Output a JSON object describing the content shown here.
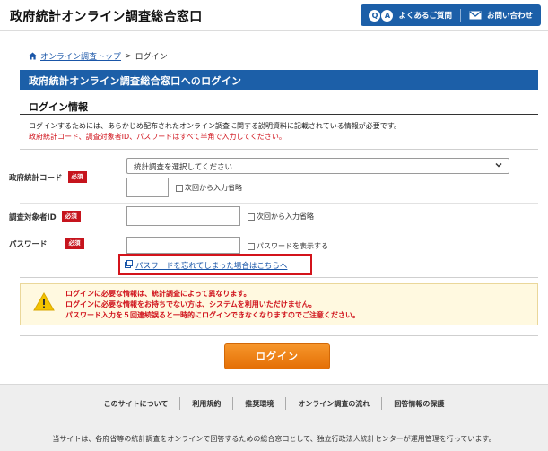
{
  "header": {
    "site_title": "政府統計オンライン調査総合窓口",
    "faq_label": "よくあるご質問",
    "contact_label": "お問い合わせ",
    "brand_color": "#1c5fa8"
  },
  "breadcrumb": {
    "home_label": "オンライン調査トップ",
    "separator": ">",
    "current": "ログイン"
  },
  "page_heading": "政府統計オンライン調査総合窓口へのログイン",
  "section_title": "ログイン情報",
  "intro": {
    "line1": "ログインするためには、あらかじめ配布されたオンライン調査に関する説明資料に記載されている情報が必要です。",
    "line2": "政府統計コード、調査対象者ID、パスワードはすべて半角で入力してください。"
  },
  "form": {
    "required_badge": "必須",
    "survey_code": {
      "label": "政府統計コード",
      "select_value": "統計調査を選択してください",
      "checkbox_label": "次回から入力省略"
    },
    "respondent_id": {
      "label": "調査対象者ID",
      "checkbox_label": "次回から入力省略"
    },
    "password": {
      "label": "パスワード",
      "checkbox_label": "パスワードを表示する"
    },
    "forgot_link": "パスワードを忘れてしまった場合はこちらへ"
  },
  "warning": {
    "line1": "ログインに必要な情報は、統計調査によって異なります。",
    "line2": "ログインに必要な情報をお持ちでない方は、システムを利用いただけません。",
    "line3": "パスワード入力を５回連続誤ると一時的にログインできなくなりますのでご注意ください。"
  },
  "login_button": "ログイン",
  "footer": {
    "links": [
      "このサイトについて",
      "利用規約",
      "推奨環境",
      "オンライン調査の流れ",
      "回答情報の保護"
    ],
    "text": "当サイトは、各府省等の統計調査をオンラインで回答するための総合窓口として、独立行政法人統計センターが運用管理を行っています。"
  },
  "icons": [
    "qa-icon",
    "mail-icon",
    "home-icon",
    "chevron-down-icon",
    "external-link-icon",
    "warning-icon"
  ]
}
